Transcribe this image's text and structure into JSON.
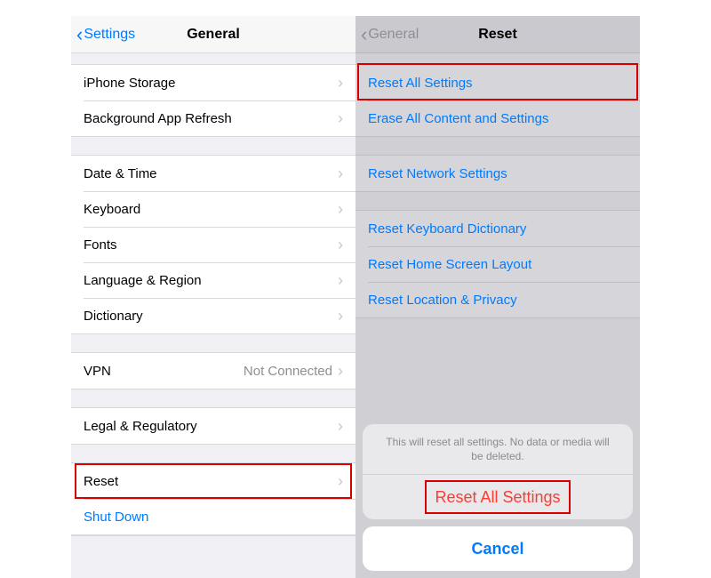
{
  "left": {
    "back_label": "Settings",
    "title": "General",
    "group1": [
      {
        "label": "iPhone Storage"
      },
      {
        "label": "Background App Refresh"
      }
    ],
    "group2": [
      {
        "label": "Date & Time"
      },
      {
        "label": "Keyboard"
      },
      {
        "label": "Fonts"
      },
      {
        "label": "Language & Region"
      },
      {
        "label": "Dictionary"
      }
    ],
    "group3": [
      {
        "label": "VPN",
        "detail": "Not Connected"
      }
    ],
    "group4": [
      {
        "label": "Legal & Regulatory"
      }
    ],
    "group5": [
      {
        "label": "Reset"
      },
      {
        "label": "Shut Down"
      }
    ]
  },
  "right": {
    "back_label": "General",
    "title": "Reset",
    "group1": [
      {
        "label": "Reset All Settings"
      },
      {
        "label": "Erase All Content and Settings"
      }
    ],
    "group2": [
      {
        "label": "Reset Network Settings"
      }
    ],
    "group3": [
      {
        "label": "Reset Keyboard Dictionary"
      },
      {
        "label": "Reset Home Screen Layout"
      },
      {
        "label": "Reset Location & Privacy"
      }
    ],
    "sheet": {
      "message": "This will reset all settings. No data or media will be deleted.",
      "confirm": "Reset All Settings",
      "cancel": "Cancel"
    }
  }
}
